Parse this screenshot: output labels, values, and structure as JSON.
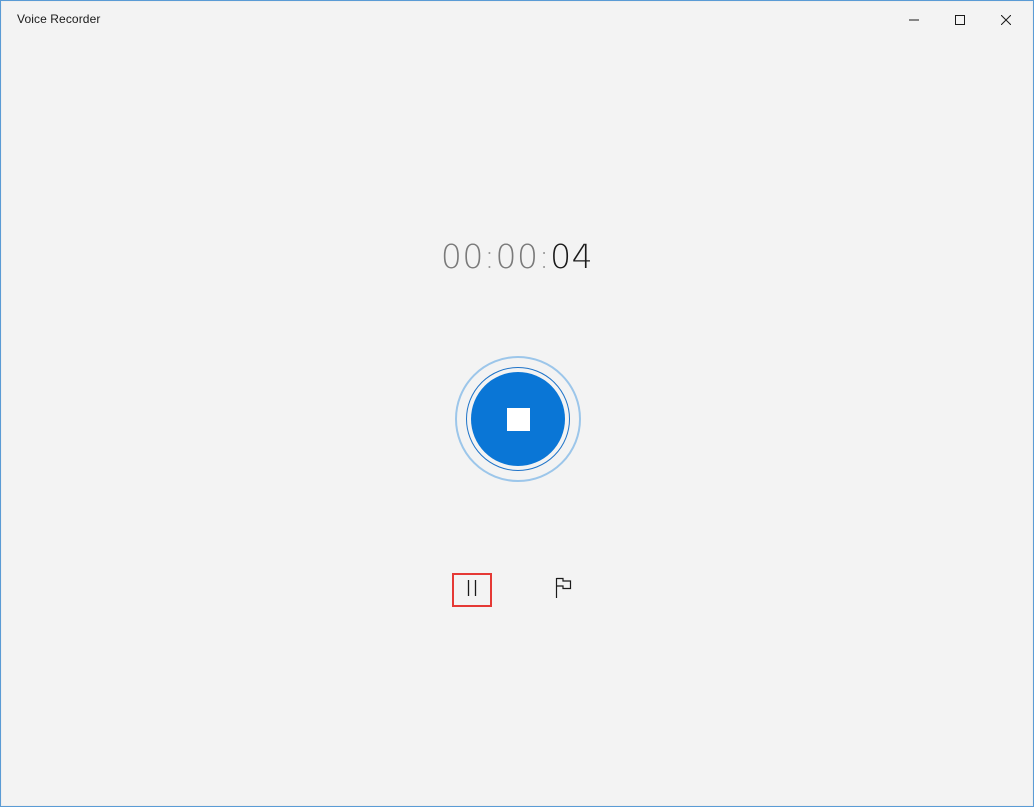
{
  "window": {
    "title": "Voice Recorder"
  },
  "caption_buttons": {
    "minimize": "minimize-icon",
    "maximize": "maximize-icon",
    "close": "close-icon"
  },
  "timer": {
    "hours": "00",
    "sep1": ":",
    "minutes": "00",
    "sep2": ":",
    "seconds": "04"
  },
  "controls": {
    "stop_icon": "stop-icon",
    "pause_icon": "pause-icon",
    "flag_icon": "flag-icon"
  },
  "colors": {
    "accent": "#0a76d6",
    "ring": "#9cc6ea",
    "highlight": "#e53935",
    "background": "#f3f3f3"
  }
}
